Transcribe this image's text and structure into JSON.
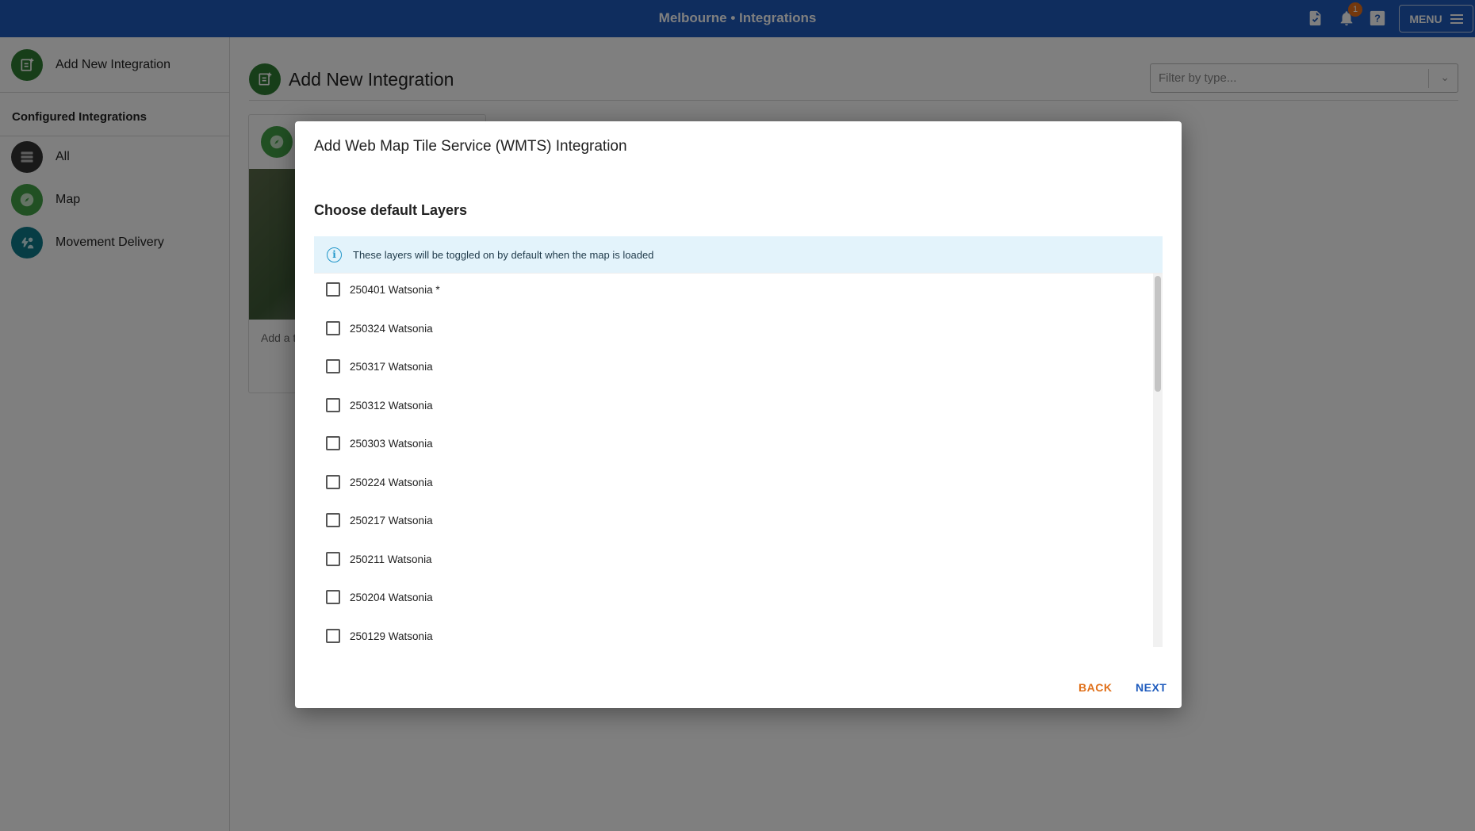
{
  "header": {
    "title": "Melbourne • Integrations",
    "notification_count": "1",
    "menu_label": "MENU",
    "accent": "#1e5bbd"
  },
  "sidebar": {
    "add_label": "Add New Integration",
    "heading": "Configured Integrations",
    "items": [
      {
        "label": "All",
        "icon": "list-icon"
      },
      {
        "label": "Map",
        "icon": "compass-icon"
      },
      {
        "label": "Movement Delivery",
        "icon": "delivery-icon"
      }
    ]
  },
  "main": {
    "title": "Add New Integration",
    "filter_placeholder": "Filter by type...",
    "card_desc": "Add a t"
  },
  "dialog": {
    "title": "Add Web Map Tile Service (WMTS) Integration",
    "heading": "Choose default Layers",
    "info": "These layers will be toggled on by default when the map is loaded",
    "layers": [
      "250401 Watsonia *",
      "250324 Watsonia",
      "250317 Watsonia",
      "250312 Watsonia",
      "250303 Watsonia",
      "250224 Watsonia",
      "250217 Watsonia",
      "250211 Watsonia",
      "250204 Watsonia",
      "250129 Watsonia"
    ],
    "back_label": "BACK",
    "next_label": "NEXT"
  }
}
